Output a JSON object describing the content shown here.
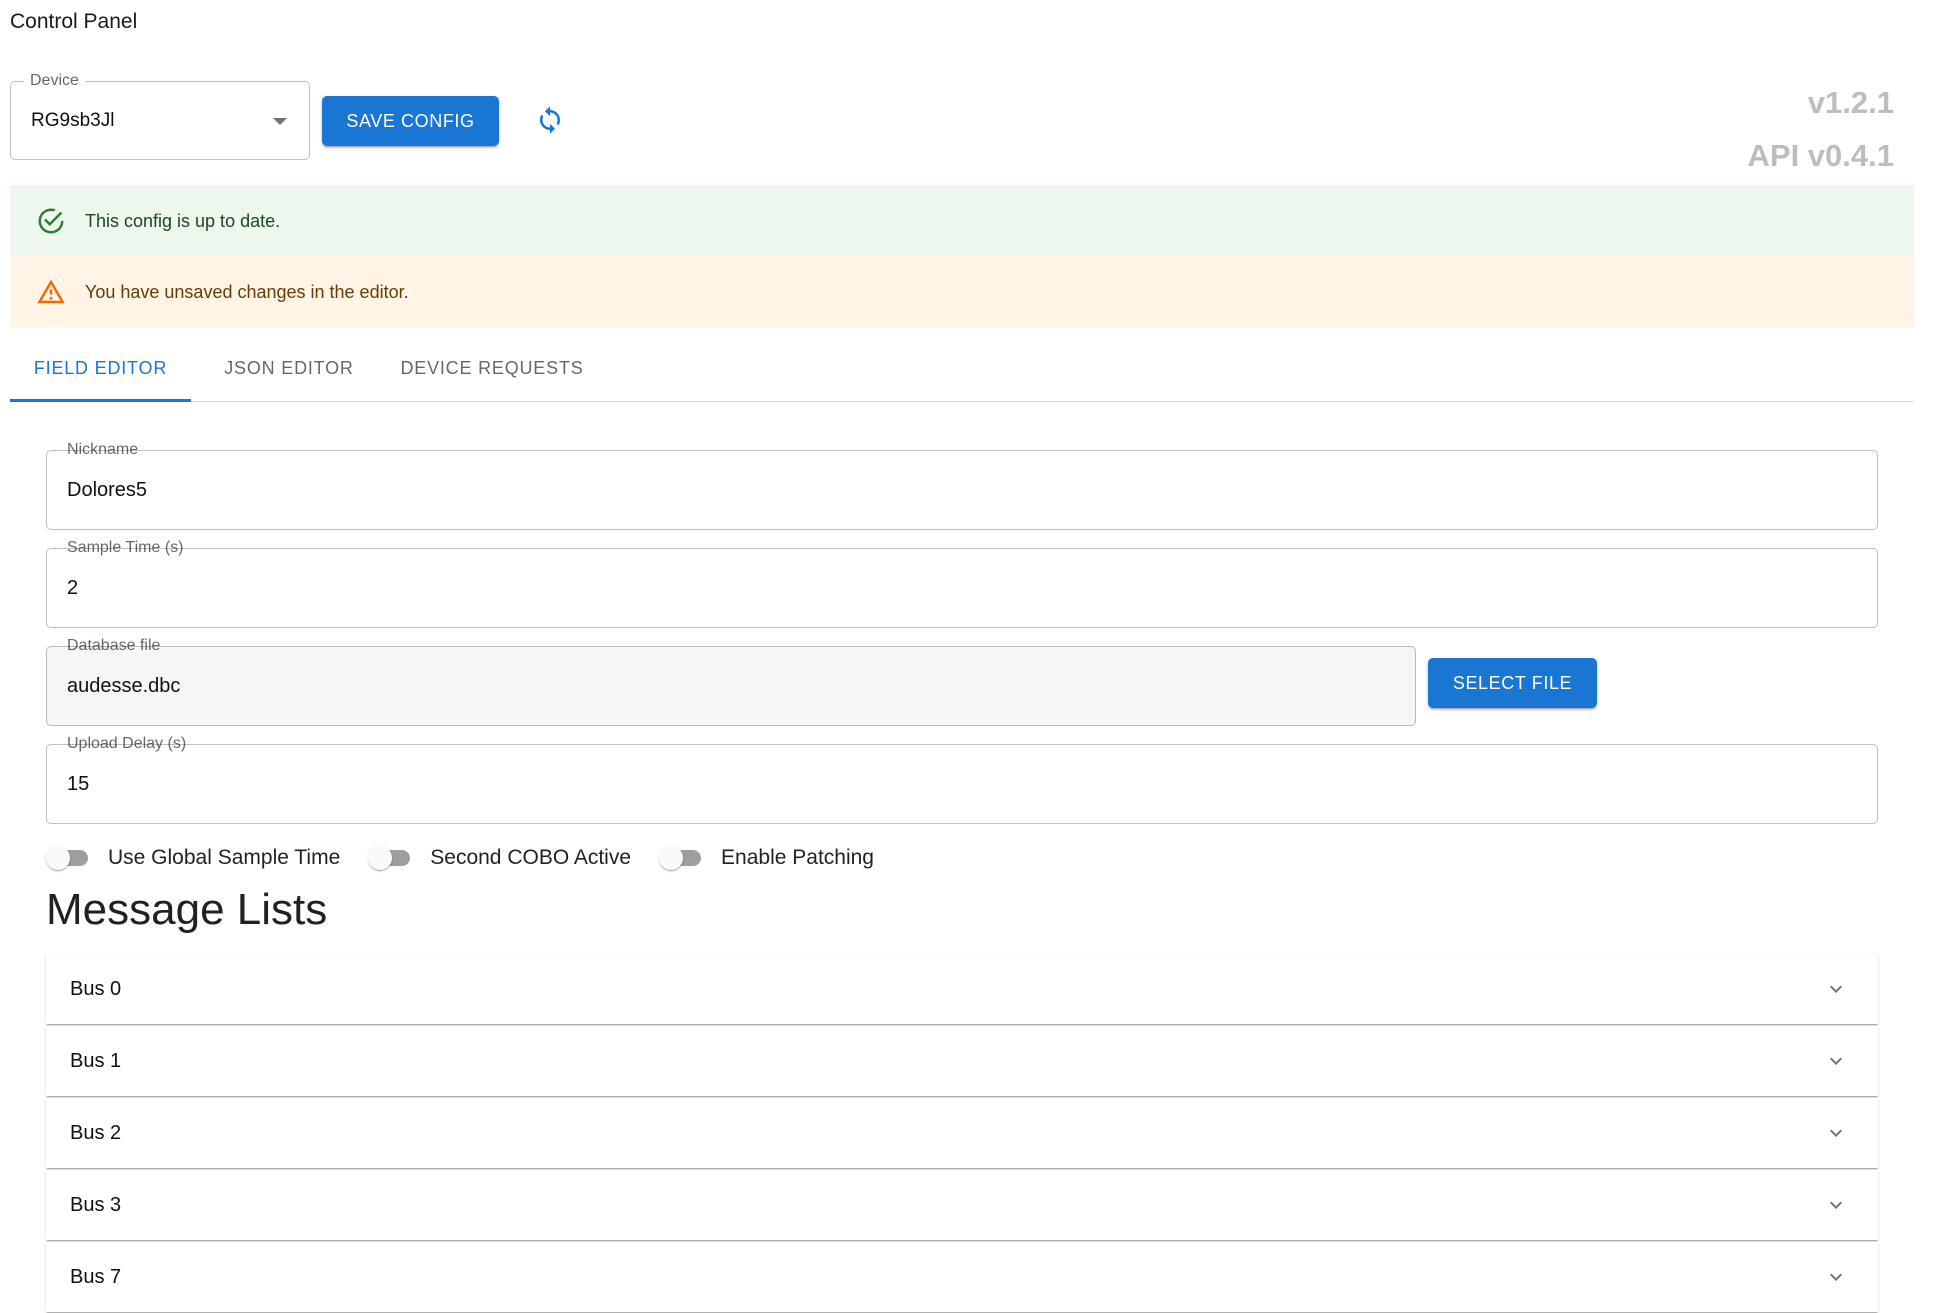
{
  "app": {
    "title": "Control Panel"
  },
  "device": {
    "label": "Device",
    "value": "RG9sb3Jl"
  },
  "toolbar": {
    "save_label": "SAVE CONFIG",
    "refresh_icon": "refresh-icon"
  },
  "versions": {
    "app": "v1.2.1",
    "api": "API v0.4.1"
  },
  "alerts": {
    "success": {
      "text": "This config is up to date.",
      "icon": "check-circle-icon",
      "color": "#2e7d32"
    },
    "warning": {
      "text": "You have unsaved changes in the editor.",
      "icon": "warning-icon",
      "color": "#ed6c02"
    }
  },
  "tabs": [
    {
      "label": "FIELD EDITOR",
      "active": true
    },
    {
      "label": "JSON EDITOR",
      "active": false
    },
    {
      "label": "DEVICE REQUESTS",
      "active": false
    }
  ],
  "form": {
    "nickname": {
      "label": "Nickname",
      "value": "Dolores5"
    },
    "sample_time": {
      "label": "Sample Time (s)",
      "value": "2"
    },
    "database_file": {
      "label": "Database file",
      "value": "audesse.dbc",
      "button": "SELECT FILE"
    },
    "upload_delay": {
      "label": "Upload Delay (s)",
      "value": "15"
    }
  },
  "switches": [
    {
      "label": "Use Global Sample Time",
      "checked": false
    },
    {
      "label": "Second COBO Active",
      "checked": false
    },
    {
      "label": "Enable Patching",
      "checked": false
    }
  ],
  "message_lists": {
    "title": "Message Lists",
    "items": [
      {
        "label": "Bus 0"
      },
      {
        "label": "Bus 1"
      },
      {
        "label": "Bus 2"
      },
      {
        "label": "Bus 3"
      },
      {
        "label": "Bus 7"
      }
    ]
  },
  "colors": {
    "primary": "#1976d2",
    "success_bg": "#edf7ed",
    "warning_bg": "#fff4e5",
    "version_text": "#bdbdbd"
  }
}
